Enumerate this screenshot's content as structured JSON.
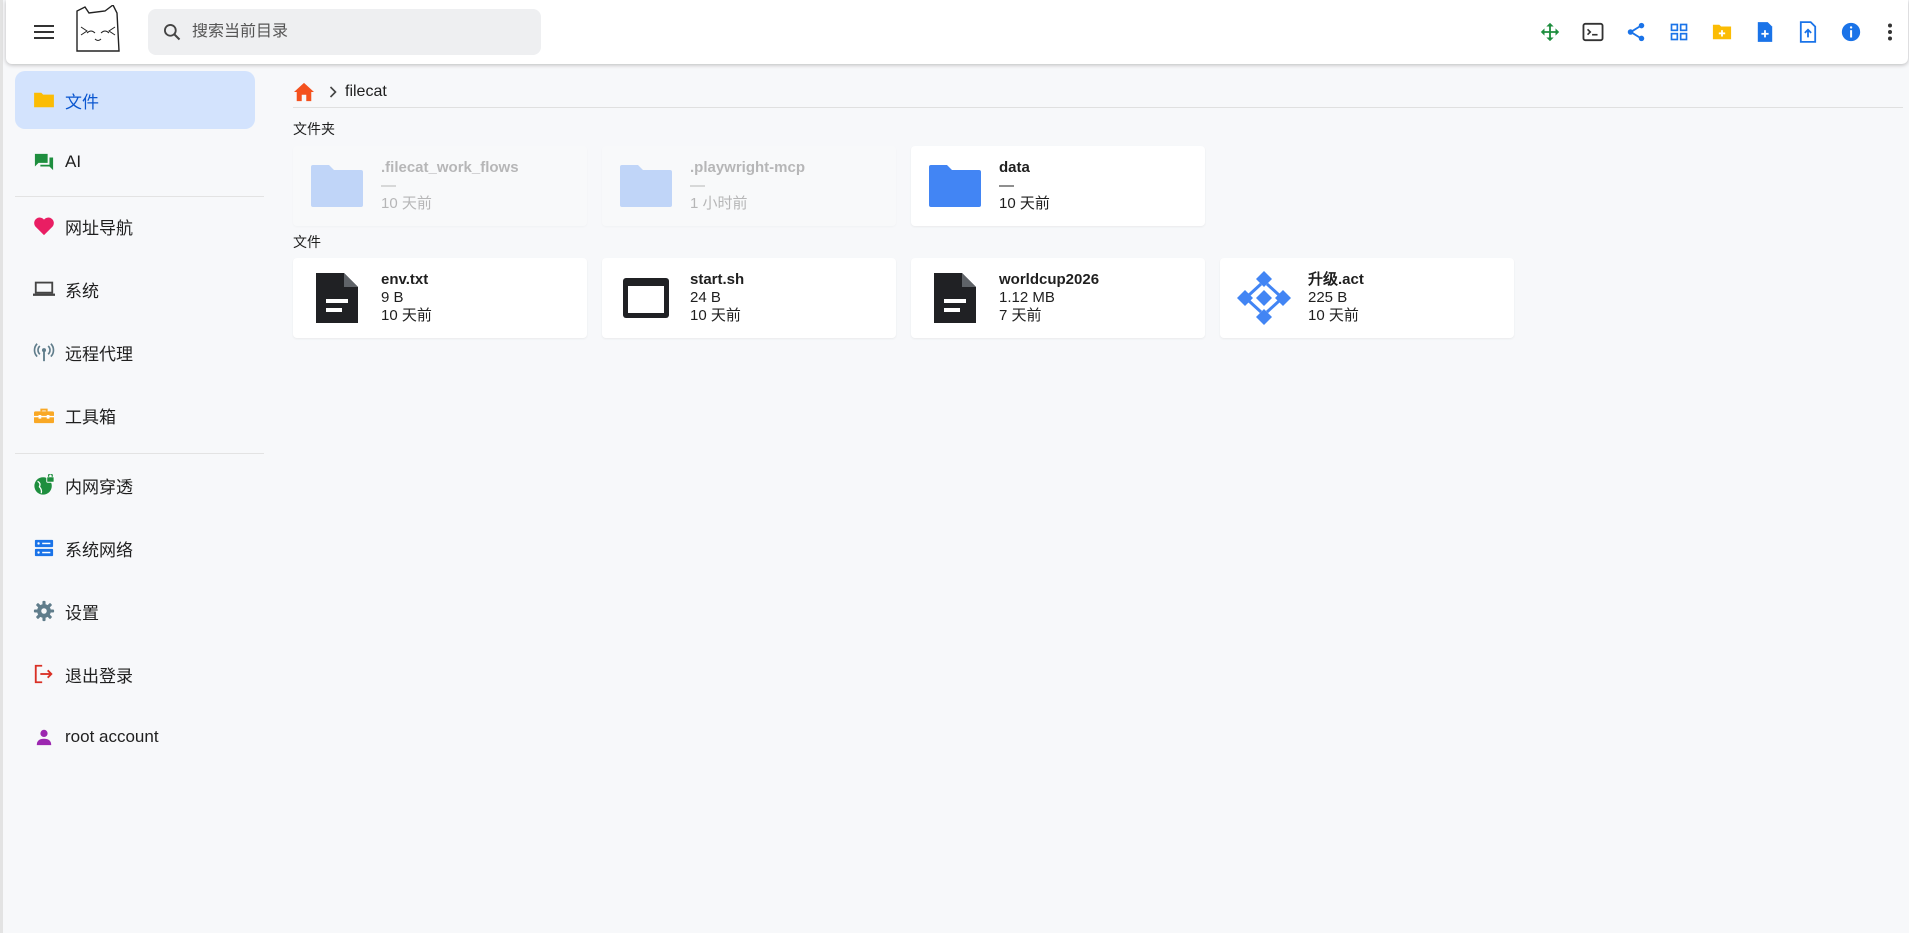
{
  "header": {
    "search_placeholder": "搜索当前目录",
    "toolbar_icons": [
      "move-icon",
      "terminal-icon",
      "share-icon",
      "grid-view-icon",
      "new-folder-icon",
      "new-file-icon",
      "upload-icon",
      "info-icon",
      "more-vert-icon"
    ]
  },
  "sidebar": {
    "items": [
      {
        "label": "文件",
        "icon": "folder-icon"
      },
      {
        "label": "AI",
        "icon": "chat-icon"
      },
      {
        "label": "网址导航",
        "icon": "heart-icon"
      },
      {
        "label": "系统",
        "icon": "laptop-icon"
      },
      {
        "label": "远程代理",
        "icon": "antenna-icon"
      },
      {
        "label": "工具箱",
        "icon": "toolbox-icon"
      },
      {
        "label": "内网穿透",
        "icon": "globe-lock-icon"
      },
      {
        "label": "系统网络",
        "icon": "server-icon"
      },
      {
        "label": "设置",
        "icon": "gear-icon"
      },
      {
        "label": "退出登录",
        "icon": "logout-icon"
      },
      {
        "label": "root account",
        "icon": "person-icon"
      }
    ]
  },
  "breadcrumb": {
    "current": "filecat"
  },
  "sections": {
    "folders_title": "文件夹",
    "files_title": "文件"
  },
  "folders": [
    {
      "name": ".filecat_work_flows",
      "size": "—",
      "time": "10 天前"
    },
    {
      "name": ".playwright-mcp",
      "size": "—",
      "time": "1 小时前"
    },
    {
      "name": "data",
      "size": "—",
      "time": "10 天前"
    }
  ],
  "files": [
    {
      "name": "env.txt",
      "size": "9 B",
      "time": "10 天前"
    },
    {
      "name": "start.sh",
      "size": "24 B",
      "time": "10 天前"
    },
    {
      "name": "worldcup2026",
      "size": "1.12 MB",
      "time": "7 天前"
    },
    {
      "name": "升级.act",
      "size": "225 B",
      "time": "10 天前"
    }
  ],
  "colors": {
    "accent": "#0b57d0",
    "active_bg": "#d3e3fd",
    "folder_blue": "#4285f4",
    "home_orange": "#f4511e"
  }
}
